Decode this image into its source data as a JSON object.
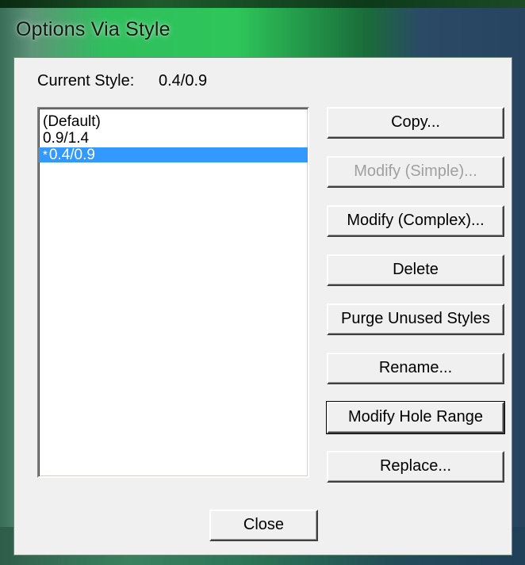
{
  "window": {
    "title": "Options Via Style"
  },
  "current_style": {
    "label": "Current Style:",
    "value": "0.4/0.9"
  },
  "style_list": [
    {
      "label": "(Default)",
      "selected": false,
      "mark": ""
    },
    {
      "label": "0.9/1.4",
      "selected": false,
      "mark": ""
    },
    {
      "label": "0.4/0.9",
      "selected": true,
      "mark": "*"
    }
  ],
  "buttons": {
    "copy": "Copy...",
    "modify_simple": "Modify (Simple)...",
    "modify_complex": "Modify (Complex)...",
    "delete": "Delete",
    "purge_unused": "Purge Unused Styles",
    "rename": "Rename...",
    "modify_hole_range": "Modify Hole Range",
    "replace": "Replace...",
    "close": "Close"
  },
  "colors": {
    "selection": "#3399ff",
    "disabled_text": "#a0a0a0",
    "dialog_face": "#f0f0f0"
  }
}
